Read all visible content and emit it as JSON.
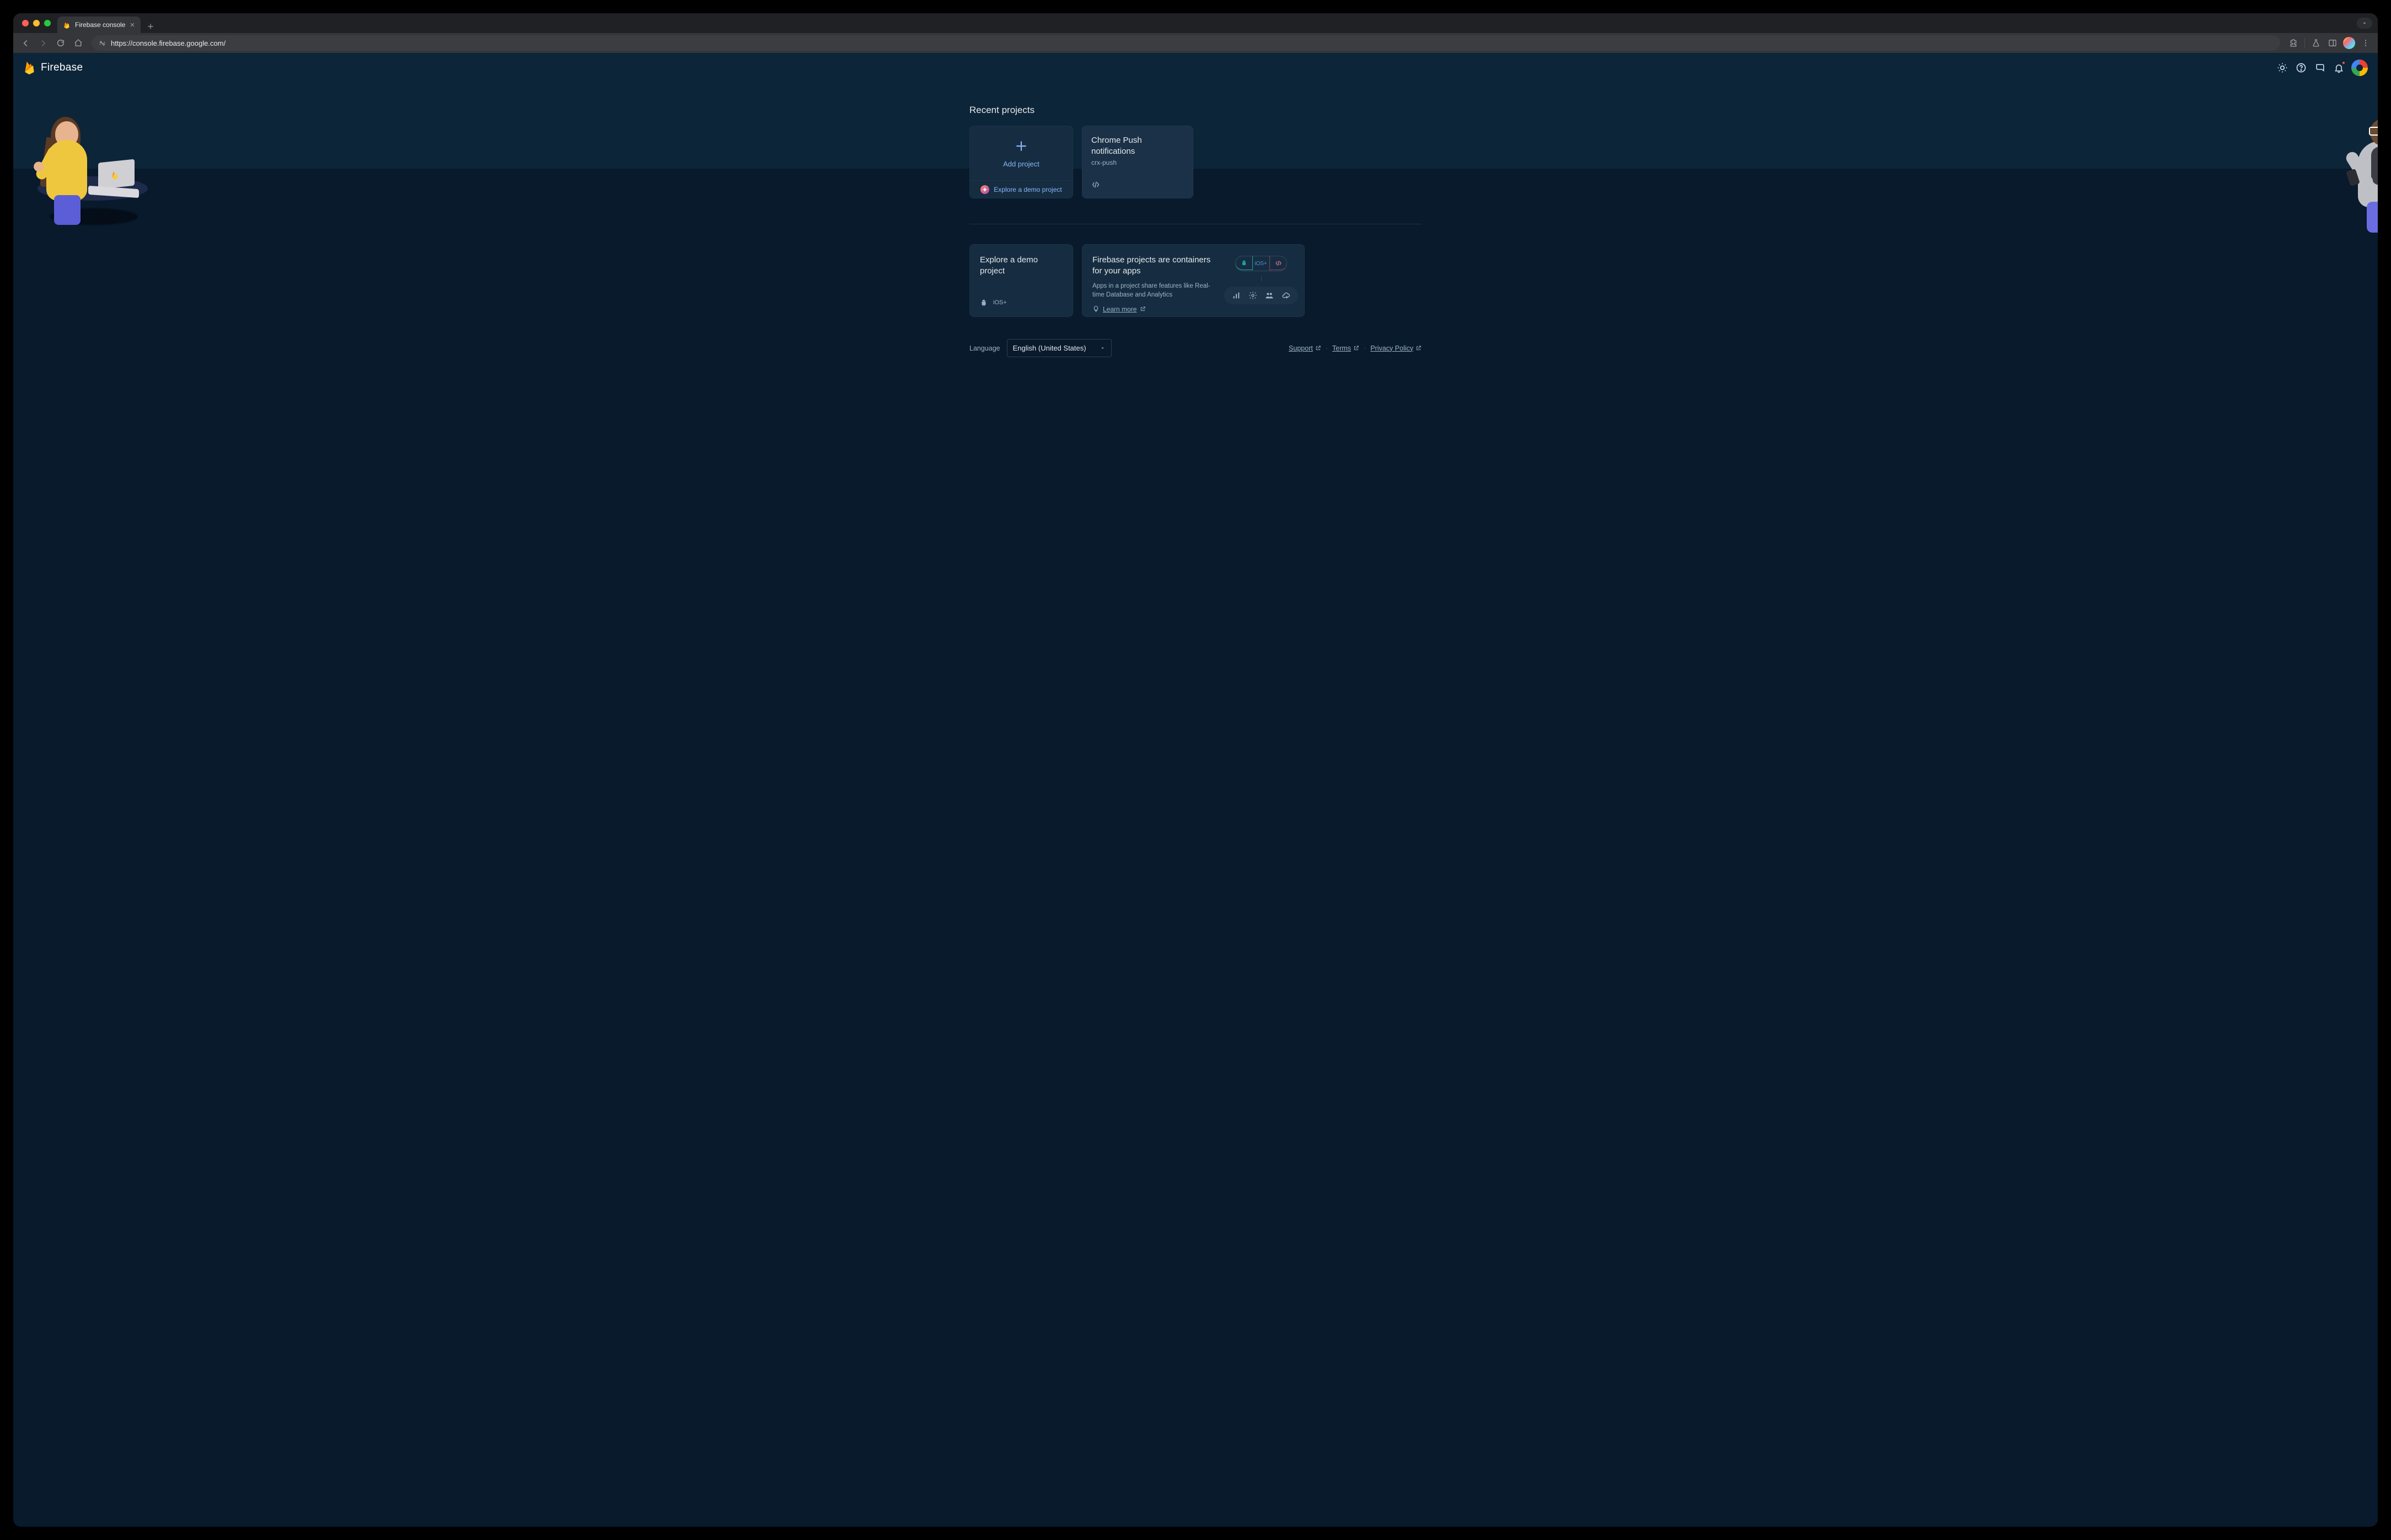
{
  "browser": {
    "tab_title": "Firebase console",
    "url": "https://console.firebase.google.com/"
  },
  "header": {
    "brand": "Firebase"
  },
  "recent": {
    "title": "Recent projects",
    "add_label": "Add project",
    "demo_label": "Explore a demo project",
    "projects": [
      {
        "name": "Chrome Push notifications",
        "id": "crx-push"
      }
    ]
  },
  "cards": {
    "explore_title": "Explore a demo project",
    "containers_title": "Firebase projects are containers for your apps",
    "containers_sub": "Apps in a project share features like Real-time Database and Analytics",
    "learn_more": "Learn more",
    "ios_label": "iOS+"
  },
  "footer": {
    "language_label": "Language",
    "language_value": "English (United States)",
    "support": "Support",
    "terms": "Terms",
    "privacy": "Privacy Policy"
  }
}
